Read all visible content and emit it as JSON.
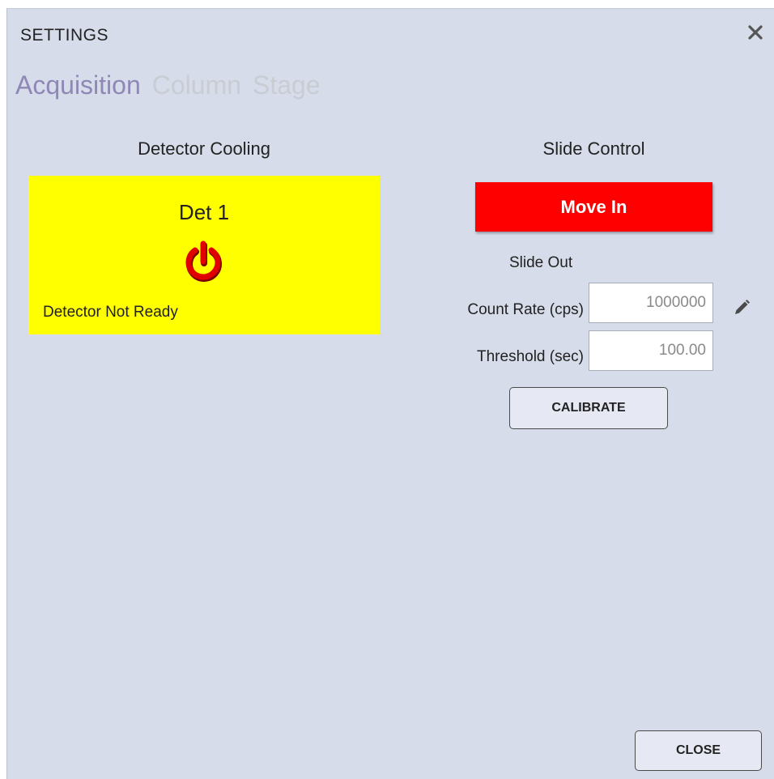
{
  "dialog": {
    "title": "SETTINGS",
    "close_icon": "close-x-icon"
  },
  "tabs": [
    {
      "label": "Acquisition",
      "active": true
    },
    {
      "label": "Column",
      "active": false
    },
    {
      "label": "Stage",
      "active": false
    }
  ],
  "detector_cooling": {
    "heading": "Detector Cooling",
    "card": {
      "name": "Det 1",
      "status": "Detector Not Ready",
      "background": "#ffff00",
      "power_icon": "power-icon",
      "power_color": "#e00000"
    }
  },
  "slide_control": {
    "heading": "Slide Control",
    "move_button": "Move In",
    "move_button_color": "#ff0000",
    "state": "Slide Out",
    "count_rate": {
      "label": "Count Rate (cps)",
      "value": "1000000"
    },
    "threshold": {
      "label": "Threshold (sec)",
      "value": "100.00"
    },
    "edit_icon": "pencil-icon",
    "calibrate_button": "CALIBRATE"
  },
  "footer": {
    "close_button": "CLOSE"
  }
}
